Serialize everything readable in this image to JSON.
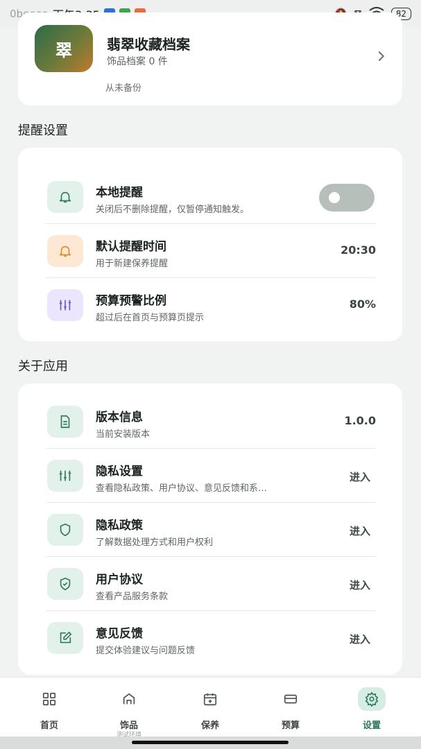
{
  "status_bar": {
    "carrier": "0beeea",
    "time": "下午3:35",
    "battery": "82"
  },
  "profile": {
    "avatar_text": "翠",
    "title": "翡翠收藏档案",
    "subtitle": "饰品档案 0 件",
    "backup": "从未备份"
  },
  "reminder_section": {
    "title": "提醒设置",
    "items": [
      {
        "icon": "bell-icon",
        "title": "本地提醒",
        "desc": "关闭后不删除提醒，仅暂停通知触发。",
        "toggle": false
      },
      {
        "icon": "bell-icon",
        "title": "默认提醒时间",
        "desc": "用于新建保养提醒",
        "value": "20:30"
      },
      {
        "icon": "sliders-icon",
        "title": "预算预警比例",
        "desc": "超过后在首页与预算页提示",
        "value": "80%"
      }
    ]
  },
  "about_section": {
    "title": "关于应用",
    "items": [
      {
        "icon": "document-icon",
        "title": "版本信息",
        "desc": "当前安装版本",
        "value": "1.0.0"
      },
      {
        "icon": "sliders-icon",
        "title": "隐私设置",
        "desc": "查看隐私政策、用户协议、意见反馈和系…",
        "action": "进入"
      },
      {
        "icon": "shield-icon",
        "title": "隐私政策",
        "desc": "了解数据处理方式和用户权利",
        "action": "进入"
      },
      {
        "icon": "shield-check-icon",
        "title": "用户协议",
        "desc": "查看产品服务条款",
        "action": "进入"
      },
      {
        "icon": "edit-icon",
        "title": "意见反馈",
        "desc": "提交体验建议与问题反馈",
        "action": "进入"
      }
    ]
  },
  "bottom_nav": {
    "items": [
      {
        "label": "首页",
        "icon": "grid-icon"
      },
      {
        "label": "饰品",
        "sub": "测试环境",
        "icon": "home-icon"
      },
      {
        "label": "保养",
        "icon": "calendar-icon"
      },
      {
        "label": "预算",
        "icon": "wallet-icon"
      },
      {
        "label": "设置",
        "icon": "gear-icon",
        "active": true
      }
    ]
  },
  "colors": {
    "accent": "#2d7a5c",
    "background": "#f1f3f2",
    "icon_green_bg": "#e3f1eb",
    "icon_orange_bg": "#fde9d3",
    "icon_purple_bg": "#ebe6fb"
  }
}
